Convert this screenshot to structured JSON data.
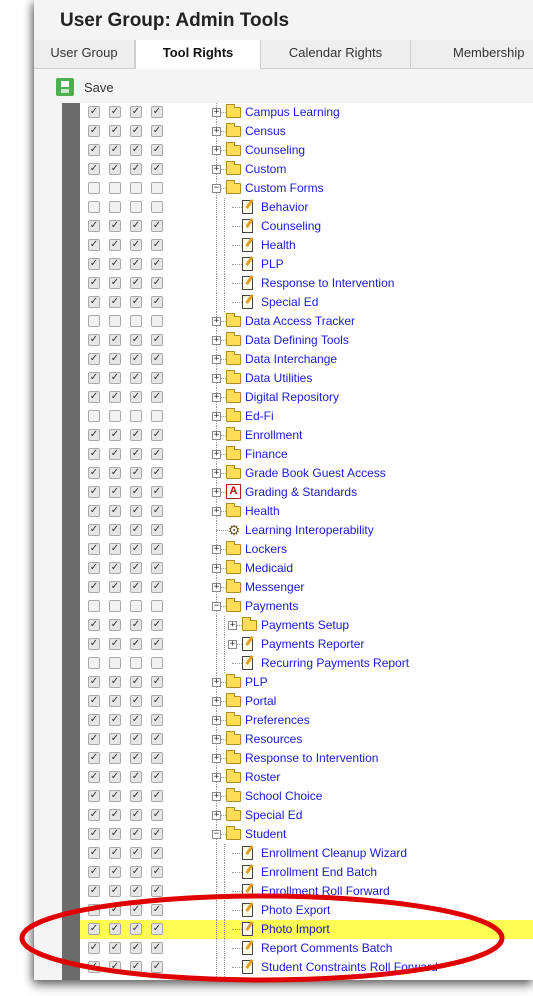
{
  "window": {
    "title": "User Group: Admin Tools"
  },
  "tabs": [
    {
      "label": "User Group",
      "active": false
    },
    {
      "label": "Tool Rights",
      "active": true
    },
    {
      "label": "Calendar Rights",
      "active": false
    },
    {
      "label": "Membership",
      "active": false
    }
  ],
  "toolbar": {
    "save_label": "Save",
    "save_icon": "save-icon"
  },
  "colors": {
    "highlight": "#fffd54",
    "link": "#1a1adb",
    "save_green": "#4caf50",
    "annotation_circle": "#e00000"
  },
  "tree": [
    {
      "label": "Campus Learning",
      "depth": 0,
      "icon": "folder",
      "expander": "+",
      "checks": [
        true,
        true,
        true,
        true
      ]
    },
    {
      "label": "Census",
      "depth": 0,
      "icon": "folder",
      "expander": "+",
      "checks": [
        true,
        true,
        true,
        true
      ]
    },
    {
      "label": "Counseling",
      "depth": 0,
      "icon": "folder",
      "expander": "+",
      "checks": [
        true,
        true,
        true,
        true
      ]
    },
    {
      "label": "Custom",
      "depth": 0,
      "icon": "folder",
      "expander": "+",
      "checks": [
        true,
        true,
        true,
        true
      ]
    },
    {
      "label": "Custom Forms",
      "depth": 0,
      "icon": "folder",
      "expander": "-",
      "checks": [
        false,
        false,
        false,
        false
      ]
    },
    {
      "label": "Behavior",
      "depth": 1,
      "icon": "document",
      "expander": "",
      "checks": [
        false,
        false,
        false,
        false
      ]
    },
    {
      "label": "Counseling",
      "depth": 1,
      "icon": "document",
      "expander": "",
      "checks": [
        true,
        true,
        true,
        true
      ]
    },
    {
      "label": "Health",
      "depth": 1,
      "icon": "document",
      "expander": "",
      "checks": [
        true,
        true,
        true,
        true
      ]
    },
    {
      "label": "PLP",
      "depth": 1,
      "icon": "document",
      "expander": "",
      "checks": [
        true,
        true,
        true,
        true
      ]
    },
    {
      "label": "Response to Intervention",
      "depth": 1,
      "icon": "document",
      "expander": "",
      "checks": [
        true,
        true,
        true,
        true
      ]
    },
    {
      "label": "Special Ed",
      "depth": 1,
      "icon": "document",
      "expander": "",
      "checks": [
        true,
        true,
        true,
        true
      ]
    },
    {
      "label": "Data Access Tracker",
      "depth": 0,
      "icon": "folder",
      "expander": "+",
      "checks": [
        false,
        false,
        false,
        false
      ]
    },
    {
      "label": "Data Defining Tools",
      "depth": 0,
      "icon": "folder",
      "expander": "+",
      "checks": [
        true,
        true,
        true,
        true
      ]
    },
    {
      "label": "Data Interchange",
      "depth": 0,
      "icon": "folder",
      "expander": "+",
      "checks": [
        true,
        true,
        true,
        true
      ]
    },
    {
      "label": "Data Utilities",
      "depth": 0,
      "icon": "folder",
      "expander": "+",
      "checks": [
        true,
        true,
        true,
        true
      ]
    },
    {
      "label": "Digital Repository",
      "depth": 0,
      "icon": "folder",
      "expander": "+",
      "checks": [
        true,
        true,
        true,
        true
      ]
    },
    {
      "label": "Ed-Fi",
      "depth": 0,
      "icon": "folder",
      "expander": "+",
      "checks": [
        false,
        false,
        false,
        false
      ]
    },
    {
      "label": "Enrollment",
      "depth": 0,
      "icon": "folder",
      "expander": "+",
      "checks": [
        true,
        true,
        true,
        true
      ]
    },
    {
      "label": "Finance",
      "depth": 0,
      "icon": "folder",
      "expander": "+",
      "checks": [
        true,
        true,
        true,
        true
      ]
    },
    {
      "label": "Grade Book Guest Access",
      "depth": 0,
      "icon": "folder",
      "expander": "+",
      "checks": [
        true,
        true,
        true,
        true
      ]
    },
    {
      "label": "Grading & Standards",
      "depth": 0,
      "icon": "grading",
      "expander": "+",
      "checks": [
        true,
        true,
        true,
        true
      ]
    },
    {
      "label": "Health",
      "depth": 0,
      "icon": "folder",
      "expander": "+",
      "checks": [
        true,
        true,
        true,
        true
      ]
    },
    {
      "label": "Learning Interoperability",
      "depth": 0,
      "icon": "gear",
      "expander": "",
      "checks": [
        true,
        true,
        true,
        true
      ]
    },
    {
      "label": "Lockers",
      "depth": 0,
      "icon": "folder",
      "expander": "+",
      "checks": [
        true,
        true,
        true,
        true
      ]
    },
    {
      "label": "Medicaid",
      "depth": 0,
      "icon": "folder",
      "expander": "+",
      "checks": [
        true,
        true,
        true,
        true
      ]
    },
    {
      "label": "Messenger",
      "depth": 0,
      "icon": "folder",
      "expander": "+",
      "checks": [
        true,
        true,
        true,
        true
      ]
    },
    {
      "label": "Payments",
      "depth": 0,
      "icon": "folder",
      "expander": "-",
      "checks": [
        false,
        false,
        false,
        false
      ]
    },
    {
      "label": "Payments Setup",
      "depth": 1,
      "icon": "folder",
      "expander": "+",
      "checks": [
        true,
        true,
        true,
        true
      ]
    },
    {
      "label": "Payments Reporter",
      "depth": 1,
      "icon": "document",
      "expander": "+",
      "checks": [
        true,
        true,
        true,
        true
      ]
    },
    {
      "label": "Recurring Payments Report",
      "depth": 1,
      "icon": "document",
      "expander": "",
      "checks": [
        false,
        false,
        false,
        false
      ]
    },
    {
      "label": "PLP",
      "depth": 0,
      "icon": "folder",
      "expander": "+",
      "checks": [
        true,
        true,
        true,
        true
      ]
    },
    {
      "label": "Portal",
      "depth": 0,
      "icon": "folder",
      "expander": "+",
      "checks": [
        true,
        true,
        true,
        true
      ]
    },
    {
      "label": "Preferences",
      "depth": 0,
      "icon": "folder",
      "expander": "+",
      "checks": [
        true,
        true,
        true,
        true
      ]
    },
    {
      "label": "Resources",
      "depth": 0,
      "icon": "folder",
      "expander": "+",
      "checks": [
        true,
        true,
        true,
        true
      ]
    },
    {
      "label": "Response to Intervention",
      "depth": 0,
      "icon": "folder",
      "expander": "+",
      "checks": [
        true,
        true,
        true,
        true
      ]
    },
    {
      "label": "Roster",
      "depth": 0,
      "icon": "folder",
      "expander": "+",
      "checks": [
        true,
        true,
        true,
        true
      ]
    },
    {
      "label": "School Choice",
      "depth": 0,
      "icon": "folder",
      "expander": "+",
      "checks": [
        true,
        true,
        true,
        true
      ]
    },
    {
      "label": "Special Ed",
      "depth": 0,
      "icon": "folder",
      "expander": "+",
      "checks": [
        true,
        true,
        true,
        true
      ]
    },
    {
      "label": "Student",
      "depth": 0,
      "icon": "folder",
      "expander": "-",
      "checks": [
        true,
        true,
        true,
        true
      ]
    },
    {
      "label": "Enrollment Cleanup Wizard",
      "depth": 1,
      "icon": "document",
      "expander": "",
      "checks": [
        true,
        true,
        true,
        true
      ]
    },
    {
      "label": "Enrollment End Batch",
      "depth": 1,
      "icon": "document",
      "expander": "",
      "checks": [
        true,
        true,
        true,
        true
      ]
    },
    {
      "label": "Enrollment Roll Forward",
      "depth": 1,
      "icon": "document",
      "expander": "",
      "checks": [
        true,
        true,
        true,
        true
      ]
    },
    {
      "label": "Photo Export",
      "depth": 1,
      "icon": "document",
      "expander": "",
      "checks": [
        true,
        true,
        true,
        true
      ]
    },
    {
      "label": "Photo Import",
      "depth": 1,
      "icon": "document",
      "expander": "",
      "checks": [
        true,
        true,
        true,
        true
      ],
      "highlighted": true
    },
    {
      "label": "Report Comments Batch",
      "depth": 1,
      "icon": "document",
      "expander": "",
      "checks": [
        true,
        true,
        true,
        true
      ]
    },
    {
      "label": "Student Constraints Roll Forward",
      "depth": 1,
      "icon": "document",
      "expander": "",
      "checks": [
        true,
        true,
        true,
        true
      ]
    }
  ]
}
